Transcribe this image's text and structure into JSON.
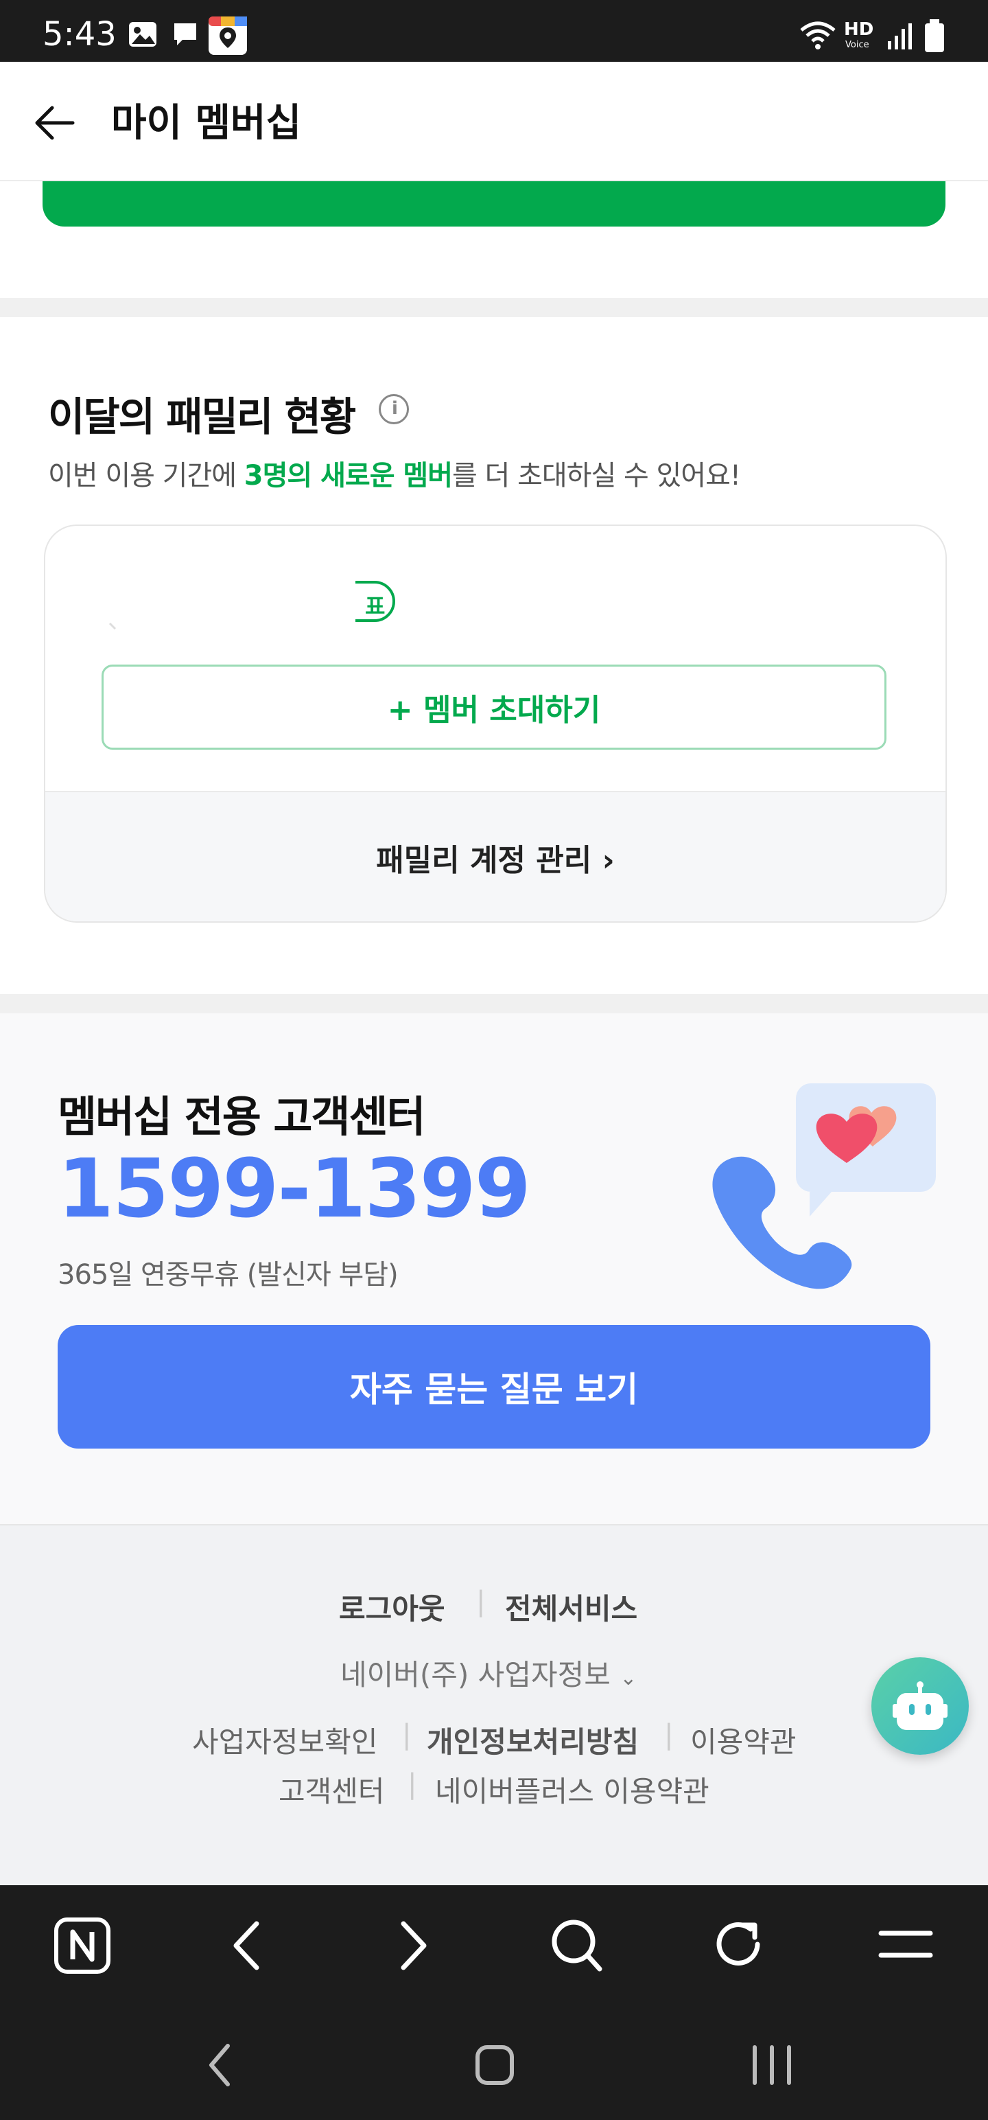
{
  "status_bar": {
    "time": "5:43",
    "hd_label": "HD",
    "voice_label": "Voice"
  },
  "header": {
    "title": "마이 멤버십"
  },
  "family": {
    "title": "이달의 패밀리 현황",
    "subtitle_pre": "이번 이용 기간에 ",
    "subtitle_highlight": "3명의 새로운 멤버",
    "subtitle_post": "를 더 초대하실 수 있어요!",
    "badge_partial": "표",
    "invite_label": "+ 멤버 초대하기",
    "manage_label": "패밀리 계정 관리 ›"
  },
  "support": {
    "title": "멤버십 전용 고객센터",
    "phone": "1599-1399",
    "note": "365일 연중무휴 (발신자 부담)",
    "faq_label": "자주 묻는 질문 보기"
  },
  "footer": {
    "logout": "로그아웃",
    "all_services": "전체서비스",
    "biz_info": "네이버(주) 사업자정보",
    "links_row1": [
      "사업자정보확인",
      "개인정보처리방침",
      "이용약관"
    ],
    "links_row2": [
      "고객센터",
      "네이버플러스 이용약관"
    ]
  },
  "colors": {
    "brand_green": "#03a94d",
    "support_blue": "#4d7cf5",
    "chatbot": "#4cc6b4"
  },
  "icons": {
    "back": "arrow-left-icon",
    "info": "info-icon",
    "phone": "phone-icon",
    "heart_bubble": "heart-chat-icon",
    "chatbot": "robot-icon",
    "browser_nav": [
      "naver-n-icon",
      "back-chevron-icon",
      "forward-chevron-icon",
      "search-icon",
      "refresh-icon",
      "menu-icon"
    ],
    "system_nav": [
      "system-back-icon",
      "home-icon",
      "recents-icon"
    ]
  }
}
